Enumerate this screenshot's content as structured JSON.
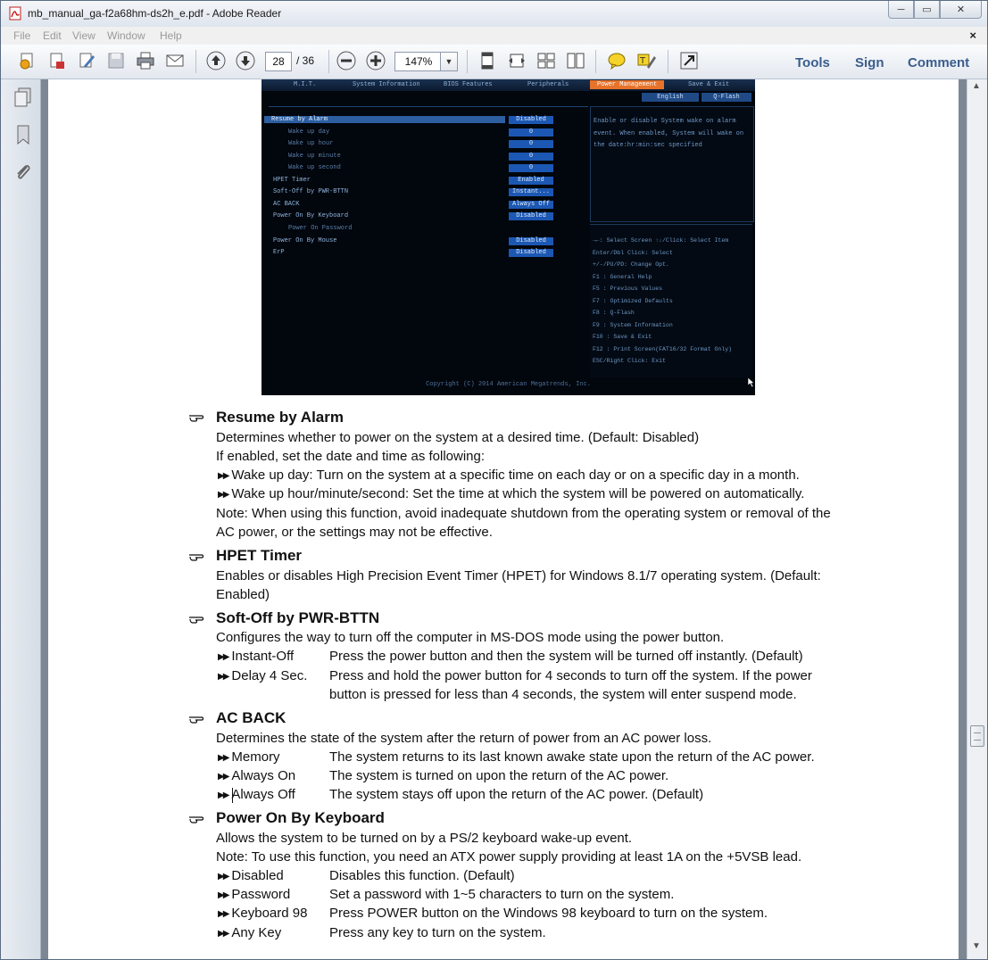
{
  "window": {
    "title": "mb_manual_ga-f2a68hm-ds2h_e.pdf - Adobe Reader",
    "min": "─",
    "max": "▭",
    "close": "✕"
  },
  "menu": {
    "items": [
      "File",
      "Edit",
      "View",
      "Window",
      "Help"
    ],
    "close": "×"
  },
  "toolbar": {
    "page_current": "28",
    "page_total": "/ 36",
    "zoom": "147%",
    "zoom_drop": "▼",
    "tools": "Tools",
    "sign": "Sign",
    "comment": "Comment"
  },
  "scrollbar": {
    "up": "▲",
    "down": "▼"
  },
  "bios": {
    "tabs": [
      "M.I.T.",
      "System Information",
      "BIOS Features",
      "Peripherals",
      "Power Management",
      "Save & Exit"
    ],
    "lang": [
      "English",
      "Q-Flash"
    ],
    "rows": [
      {
        "label": "Resume by Alarm",
        "value": "Disabled"
      },
      {
        "label": "Wake up day",
        "value": "0"
      },
      {
        "label": "Wake up hour",
        "value": "0"
      },
      {
        "label": "Wake up minute",
        "value": "0"
      },
      {
        "label": "Wake up second",
        "value": "0"
      },
      {
        "label": "HPET Timer",
        "value": "Enabled"
      },
      {
        "label": "Soft-Off by PWR-BTTN",
        "value": "Instant..."
      },
      {
        "label": "AC BACK",
        "value": "Always Off"
      },
      {
        "label": "Power On By Keyboard",
        "value": "Disabled"
      },
      {
        "label": "Power On Password",
        "value": ""
      },
      {
        "label": "Power On By Mouse",
        "value": "Disabled"
      },
      {
        "label": "ErP",
        "value": "Disabled"
      }
    ],
    "help": "Enable or disable System wake on alarm event. When enabled, System will wake on the date:hr:min:sec specified",
    "keys": [
      "→←: Select Screen  ↑↓/Click: Select Item",
      "Enter/Dbl Click: Select",
      "+/-/PU/PD: Change Opt.",
      "F1  : General Help",
      "F5  : Previous Values",
      "F7  : Optimized Defaults",
      "F8  : Q-Flash",
      "F9  : System Information",
      "F10 : Save & Exit",
      "F12 : Print Screen(FAT16/32 Format Only)",
      "ESC/Right Click: Exit"
    ],
    "copyright": "Copyright (C) 2014 American Megatrends, Inc."
  },
  "manual": {
    "s1": {
      "title": "Resume by Alarm",
      "p1": "Determines whether to power on the system at a desired time. (Default: Disabled)",
      "p2": "If enabled, set the date and time as following:",
      "b1": "Wake up day: Turn on the system at a specific time on each day or on a specific day in a month.",
      "b2": "Wake up hour/minute/second: Set the time at which the system will be powered on automatically.",
      "n1": "Note: When using this function, avoid inadequate shutdown from the operating system or removal of the",
      "n2": "AC power, or the settings may not be effective."
    },
    "s2": {
      "title": "HPET Timer",
      "p1": "Enables or disables High Precision Event Timer (HPET) for Windows 8.1/7 operating system. (Default:",
      "p2": "Enabled)"
    },
    "s3": {
      "title": "Soft-Off by PWR-BTTN",
      "p1": "Configures the way to turn off the computer in MS-DOS mode using the power button.",
      "o1": "Instant-Off",
      "d1": "Press the power button and then the system will be turned off instantly. (Default)",
      "o2": "Delay 4 Sec.",
      "d2a": "Press and hold the power button for 4 seconds to turn off the system. If the power",
      "d2b": "button is pressed for less than 4 seconds, the system will enter suspend mode."
    },
    "s4": {
      "title": "AC BACK",
      "p1": "Determines the state of the system after the return of power from an AC power loss.",
      "o1": "Memory",
      "d1": "The system returns to its last known awake state upon the return of the AC power.",
      "o2": "Always On",
      "d2": "The system is turned on upon the return of the AC power.",
      "o3": "Always Off",
      "d3": "The system stays off upon the return of the AC power. (Default)"
    },
    "s5": {
      "title": "Power On By Keyboard",
      "p1": "Allows the system to be turned on by a PS/2 keyboard wake-up event.",
      "p2": "Note: To use this function, you need an ATX power supply providing at least 1A on the +5VSB lead.",
      "o1": "Disabled",
      "d1": "Disables this function. (Default)",
      "o2": "Password",
      "d2": "Set a password with 1~5 characters to turn on the system.",
      "o3": "Keyboard 98",
      "d3": "Press POWER button on the Windows 98 keyboard to turn on the system.",
      "o4": "Any Key",
      "d4": "Press any key to turn on the system."
    }
  }
}
